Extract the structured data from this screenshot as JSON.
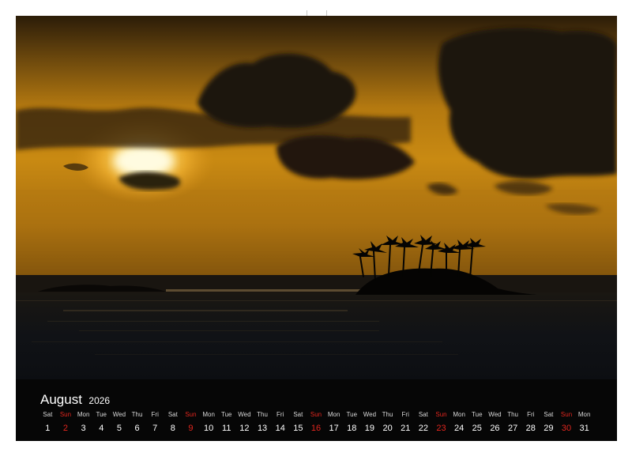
{
  "calendar": {
    "month": "August",
    "year": "2026",
    "days": [
      {
        "name": "Sat",
        "num": "1"
      },
      {
        "name": "Sun",
        "num": "2",
        "sunday": true
      },
      {
        "name": "Mon",
        "num": "3"
      },
      {
        "name": "Tue",
        "num": "4"
      },
      {
        "name": "Wed",
        "num": "5"
      },
      {
        "name": "Thu",
        "num": "6"
      },
      {
        "name": "Fri",
        "num": "7"
      },
      {
        "name": "Sat",
        "num": "8"
      },
      {
        "name": "Sun",
        "num": "9",
        "sunday": true
      },
      {
        "name": "Mon",
        "num": "10"
      },
      {
        "name": "Tue",
        "num": "11"
      },
      {
        "name": "Wed",
        "num": "12"
      },
      {
        "name": "Thu",
        "num": "13"
      },
      {
        "name": "Fri",
        "num": "14"
      },
      {
        "name": "Sat",
        "num": "15"
      },
      {
        "name": "Sun",
        "num": "16",
        "sunday": true
      },
      {
        "name": "Mon",
        "num": "17"
      },
      {
        "name": "Tue",
        "num": "18"
      },
      {
        "name": "Wed",
        "num": "19"
      },
      {
        "name": "Thu",
        "num": "20"
      },
      {
        "name": "Fri",
        "num": "21"
      },
      {
        "name": "Sat",
        "num": "22"
      },
      {
        "name": "Sun",
        "num": "23",
        "sunday": true
      },
      {
        "name": "Mon",
        "num": "24"
      },
      {
        "name": "Tue",
        "num": "25"
      },
      {
        "name": "Wed",
        "num": "26"
      },
      {
        "name": "Thu",
        "num": "27"
      },
      {
        "name": "Fri",
        "num": "28"
      },
      {
        "name": "Sat",
        "num": "29"
      },
      {
        "name": "Sun",
        "num": "30",
        "sunday": true
      },
      {
        "name": "Mon",
        "num": "31"
      }
    ]
  },
  "colors": {
    "sunday": "#e2261e",
    "weekday": "#ffffff",
    "strip_background": "#060606",
    "sky_gold": "#c98a0f",
    "sea_dark": "#0b0e12"
  },
  "photo": {
    "icons": [
      "sun-icon",
      "palm-island-icon",
      "clouds-icon",
      "sea-icon"
    ]
  }
}
